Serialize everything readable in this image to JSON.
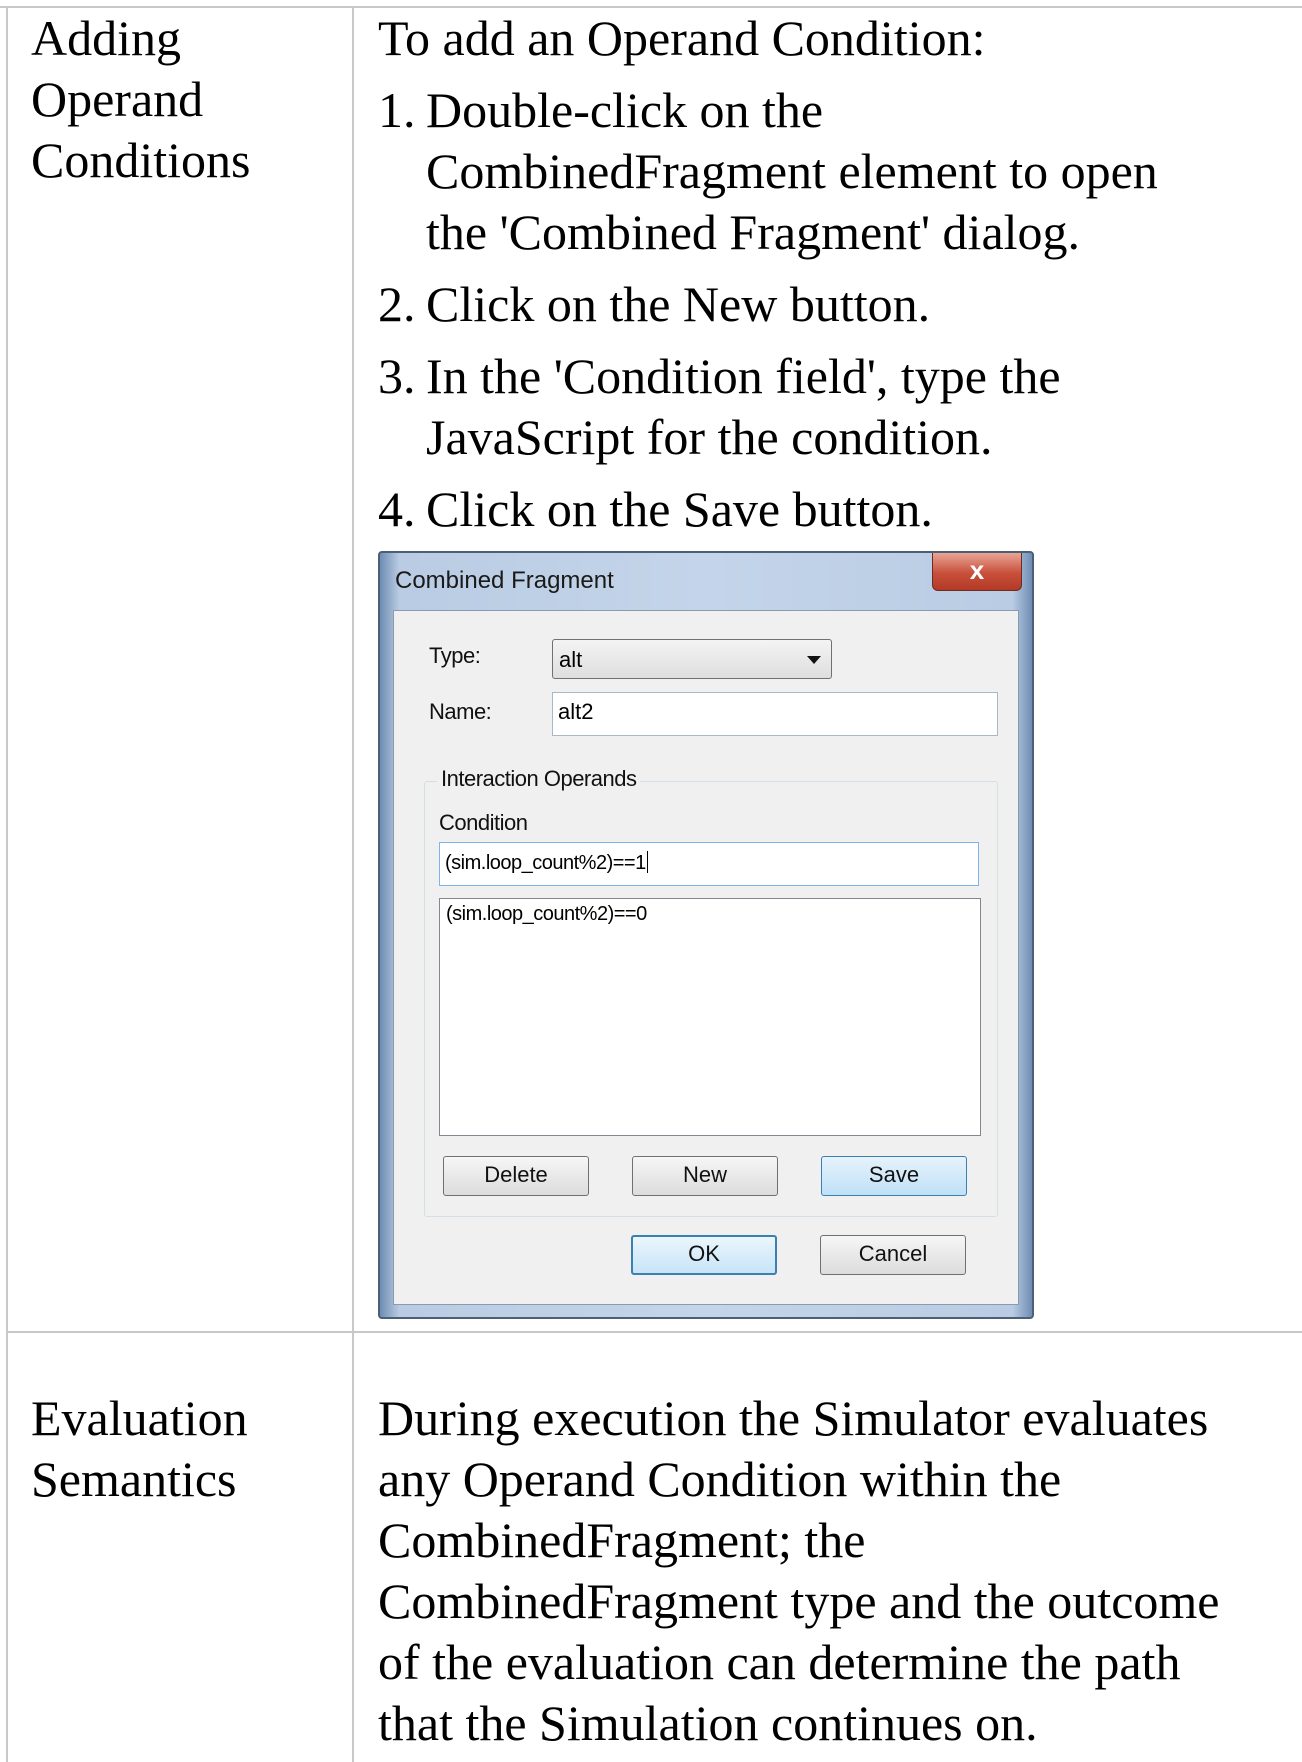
{
  "rows": [
    {
      "label_lines": [
        "Adding",
        "Operand",
        "Conditions"
      ],
      "intro": "To add an Operand Condition:",
      "steps": [
        {
          "num": "1.",
          "lines": [
            "Double-click on the",
            "CombinedFragment element to open",
            "the 'Combined Fragment' dialog."
          ]
        },
        {
          "num": "2.",
          "lines": [
            "Click on the New button."
          ]
        },
        {
          "num": "3.",
          "lines": [
            "In the 'Condition field', type the",
            "JavaScript for the condition."
          ]
        },
        {
          "num": "4.",
          "lines": [
            "Click on the Save button."
          ]
        }
      ]
    },
    {
      "label_lines": [
        "Evaluation",
        "Semantics"
      ],
      "body_lines": [
        "During execution the Simulator evaluates",
        "any Operand Condition within the",
        "CombinedFragment; the",
        "CombinedFragment type and the outcome",
        "of the evaluation can determine the path",
        "that the Simulation continues on."
      ]
    }
  ],
  "dialog": {
    "title": "Combined Fragment",
    "close_glyph": "x",
    "type_label": "Type:",
    "type_value": "alt",
    "name_label": "Name:",
    "name_value": "alt2",
    "group_label": "Interaction Operands",
    "condition_label": "Condition",
    "condition_value": "(sim.loop_count%2)==1",
    "operands": [
      "(sim.loop_count%2)==0"
    ],
    "delete_label": "Delete",
    "new_label": "New",
    "save_label": "Save",
    "ok_label": "OK",
    "cancel_label": "Cancel"
  }
}
